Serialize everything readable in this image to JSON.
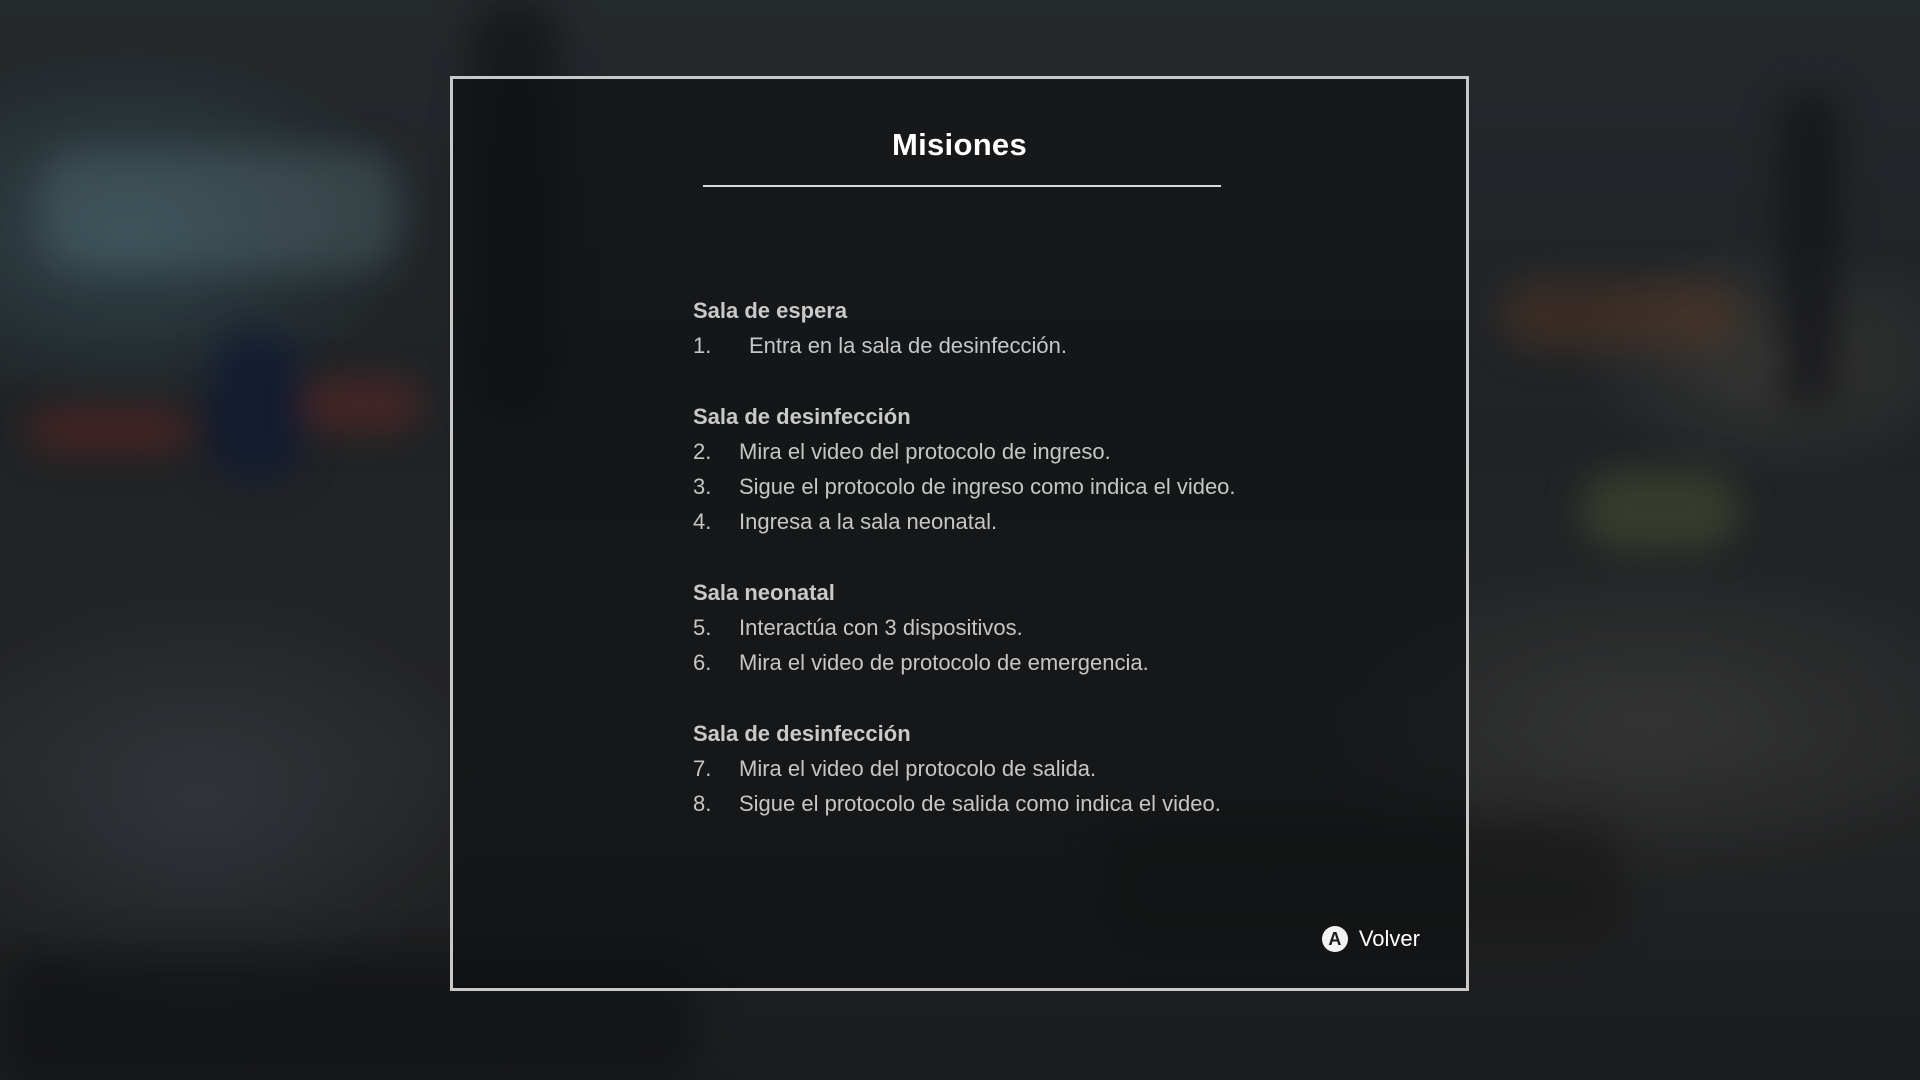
{
  "panel": {
    "title": "Misiones",
    "back_button": {
      "glyph": "A",
      "label": "Volver"
    }
  },
  "sections": [
    {
      "heading": "Sala de espera",
      "tasks": [
        {
          "number": "1.",
          "text": "Entra en la sala de desinfección."
        }
      ]
    },
    {
      "heading": "Sala de desinfección",
      "tasks": [
        {
          "number": "2.",
          "text": "Mira el video del protocolo de ingreso."
        },
        {
          "number": "3.",
          "text": "Sigue el protocolo de ingreso como indica el video."
        },
        {
          "number": "4.",
          "text": "Ingresa a la sala neonatal."
        }
      ]
    },
    {
      "heading": "Sala neonatal",
      "tasks": [
        {
          "number": "5.",
          "text": "Interactúa con 3 dispositivos."
        },
        {
          "number": "6.",
          "text": "Mira el video de protocolo de emergencia."
        }
      ]
    },
    {
      "heading": "Sala de desinfección",
      "tasks": [
        {
          "number": "7.",
          "text": "Mira el video del protocolo de salida."
        },
        {
          "number": "8.",
          "text": "Sigue el protocolo de salida como indica el video."
        }
      ]
    }
  ]
}
